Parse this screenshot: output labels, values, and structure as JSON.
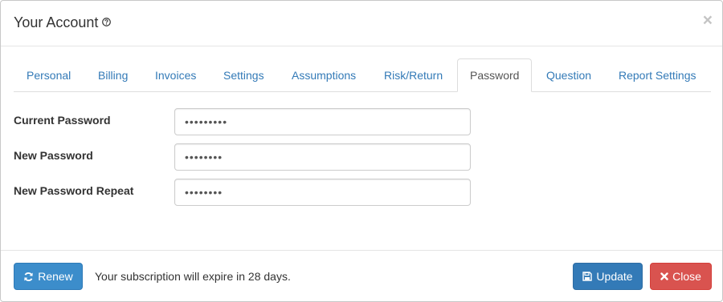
{
  "header": {
    "title": "Your Account",
    "help_icon": "question-circle-icon",
    "close_label": "×"
  },
  "tabs": [
    {
      "label": "Personal",
      "active": false
    },
    {
      "label": "Billing",
      "active": false
    },
    {
      "label": "Invoices",
      "active": false
    },
    {
      "label": "Settings",
      "active": false
    },
    {
      "label": "Assumptions",
      "active": false
    },
    {
      "label": "Risk/Return",
      "active": false
    },
    {
      "label": "Password",
      "active": true
    },
    {
      "label": "Question",
      "active": false
    },
    {
      "label": "Report Settings",
      "active": false
    }
  ],
  "form": {
    "current_password": {
      "label": "Current Password",
      "value": "•••••••••"
    },
    "new_password": {
      "label": "New Password",
      "value": "••••••••"
    },
    "new_password_repeat": {
      "label": "New Password Repeat",
      "value": "••••••••"
    }
  },
  "footer": {
    "renew_label": "Renew",
    "renew_icon": "refresh-icon",
    "subscription_message": "Your subscription will expire in 28 days.",
    "update_label": "Update",
    "update_icon": "save-icon",
    "close_label": "Close",
    "close_icon": "times-icon"
  },
  "colors": {
    "primary": "#337ab7",
    "renew": "#3c8dcb",
    "danger": "#d9534f",
    "link": "#337ab7"
  }
}
